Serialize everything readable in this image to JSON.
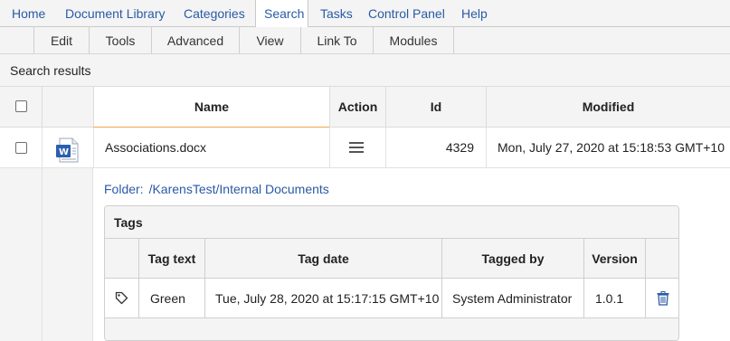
{
  "topnav": {
    "items": [
      {
        "label": "Home"
      },
      {
        "label": "Document Library"
      },
      {
        "label": "Categories"
      },
      {
        "label": "Search"
      },
      {
        "label": "Tasks"
      },
      {
        "label": "Control Panel"
      },
      {
        "label": "Help"
      }
    ],
    "active": "Search"
  },
  "subnav": {
    "items": [
      {
        "label": "Edit"
      },
      {
        "label": "Tools"
      },
      {
        "label": "Advanced"
      },
      {
        "label": "View"
      },
      {
        "label": "Link To"
      },
      {
        "label": "Modules"
      }
    ]
  },
  "results": {
    "title": "Search results",
    "columns": {
      "name": "Name",
      "action": "Action",
      "id": "Id",
      "modified": "Modified"
    },
    "rows": [
      {
        "name": "Associations.docx",
        "file_icon": "word-document-icon",
        "action_icon": "hamburger-menu-icon",
        "id": "4329",
        "modified": "Mon, July 27, 2020 at 15:18:53 GMT+10"
      }
    ]
  },
  "detail": {
    "folder_label": "Folder:",
    "folder_path": "/KarensTest/Internal Documents",
    "tags": {
      "title": "Tags",
      "columns": {
        "tag_text": "Tag text",
        "tag_date": "Tag date",
        "tagged_by": "Tagged by",
        "version": "Version"
      },
      "rows": [
        {
          "tag_icon": "tag-icon",
          "tag_text": "Green",
          "tag_date": "Tue, July 28, 2020 at 15:17:15 GMT+10",
          "tagged_by": "System Administrator",
          "version": "1.0.1",
          "delete_icon": "trash-icon"
        }
      ]
    }
  },
  "colors": {
    "link": "#2a5aa6",
    "header_bg": "#f4f4f4",
    "accent_underline": "#f0a64a"
  }
}
